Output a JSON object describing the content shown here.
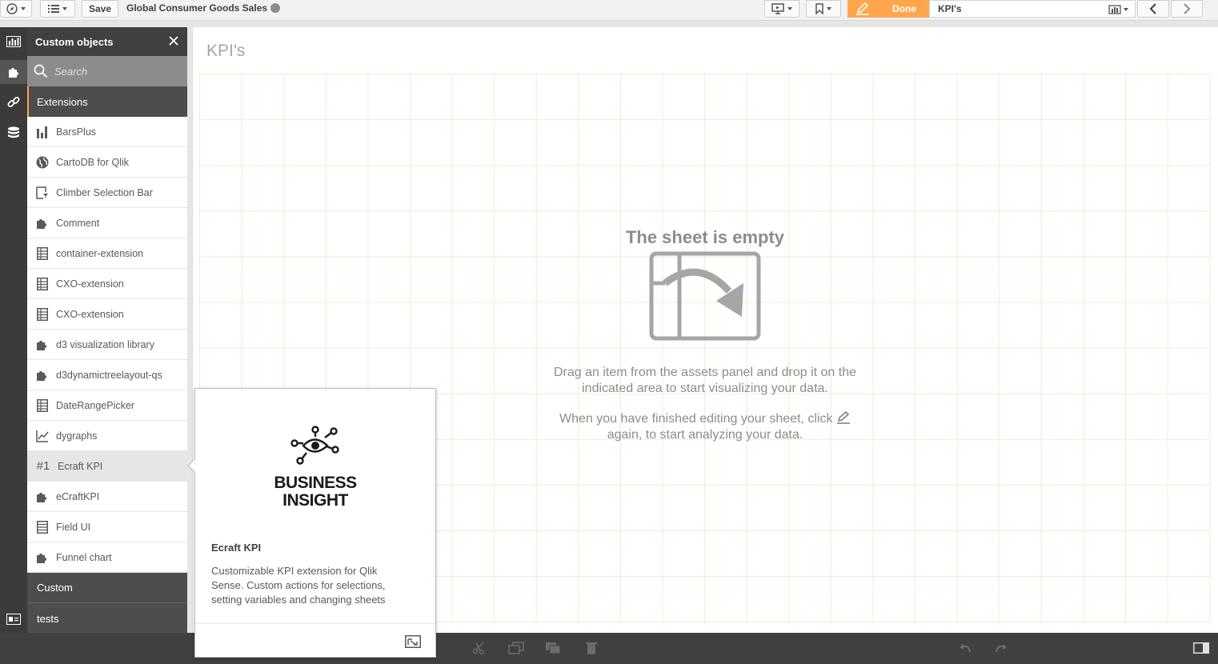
{
  "toolbar": {
    "save_label": "Save",
    "app_title": "Global Consumer Goods Sales",
    "done_label": "Done",
    "sheet_name": "KPI's"
  },
  "assets": {
    "title": "Custom objects",
    "search_placeholder": "Search",
    "sections": {
      "extensions": "Extensions",
      "custom": "Custom",
      "tests": "tests"
    },
    "items": [
      {
        "label": "BarsPlus",
        "icon": "bar-chart-icon"
      },
      {
        "label": "CartoDB for Qlik",
        "icon": "globe-icon"
      },
      {
        "label": "Climber Selection Bar",
        "icon": "filter-pane-icon"
      },
      {
        "label": "Comment",
        "icon": "puzzle-icon"
      },
      {
        "label": "container-extension",
        "icon": "table-icon"
      },
      {
        "label": "CXO-extension",
        "icon": "table-icon"
      },
      {
        "label": "CXO-extension",
        "icon": "table-icon"
      },
      {
        "label": "d3 visualization library",
        "icon": "puzzle-icon"
      },
      {
        "label": "d3dynamictreelayout-qs",
        "icon": "puzzle-icon"
      },
      {
        "label": "DateRangePicker",
        "icon": "table-icon"
      },
      {
        "label": "dygraphs",
        "icon": "line-chart-icon"
      },
      {
        "label": "Ecraft KPI",
        "icon": "kpi-icon",
        "icon_text": "#1"
      },
      {
        "label": "eCraftKPI",
        "icon": "puzzle-icon"
      },
      {
        "label": "Field UI",
        "icon": "list-icon"
      },
      {
        "label": "Funnel chart",
        "icon": "puzzle-icon"
      }
    ]
  },
  "sheet": {
    "title": "KPI's",
    "empty_title": "The sheet is empty",
    "empty_text_1": "Drag an item from the assets panel and drop it on the indicated area to start visualizing your data.",
    "empty_text_2a": "When you have finished editing your sheet, click",
    "empty_text_2b": "again, to start analyzing your data."
  },
  "popover": {
    "logo_line1": "BUSINESS",
    "logo_line2": "INSIGHT",
    "name": "Ecraft KPI",
    "description": "Customizable KPI extension for Qlik Sense. Custom actions for selections, setting variables and changing sheets"
  },
  "colors": {
    "accent": "#ffa64d",
    "panel_dark": "#404040",
    "sidebar": "#3b3b3b"
  }
}
